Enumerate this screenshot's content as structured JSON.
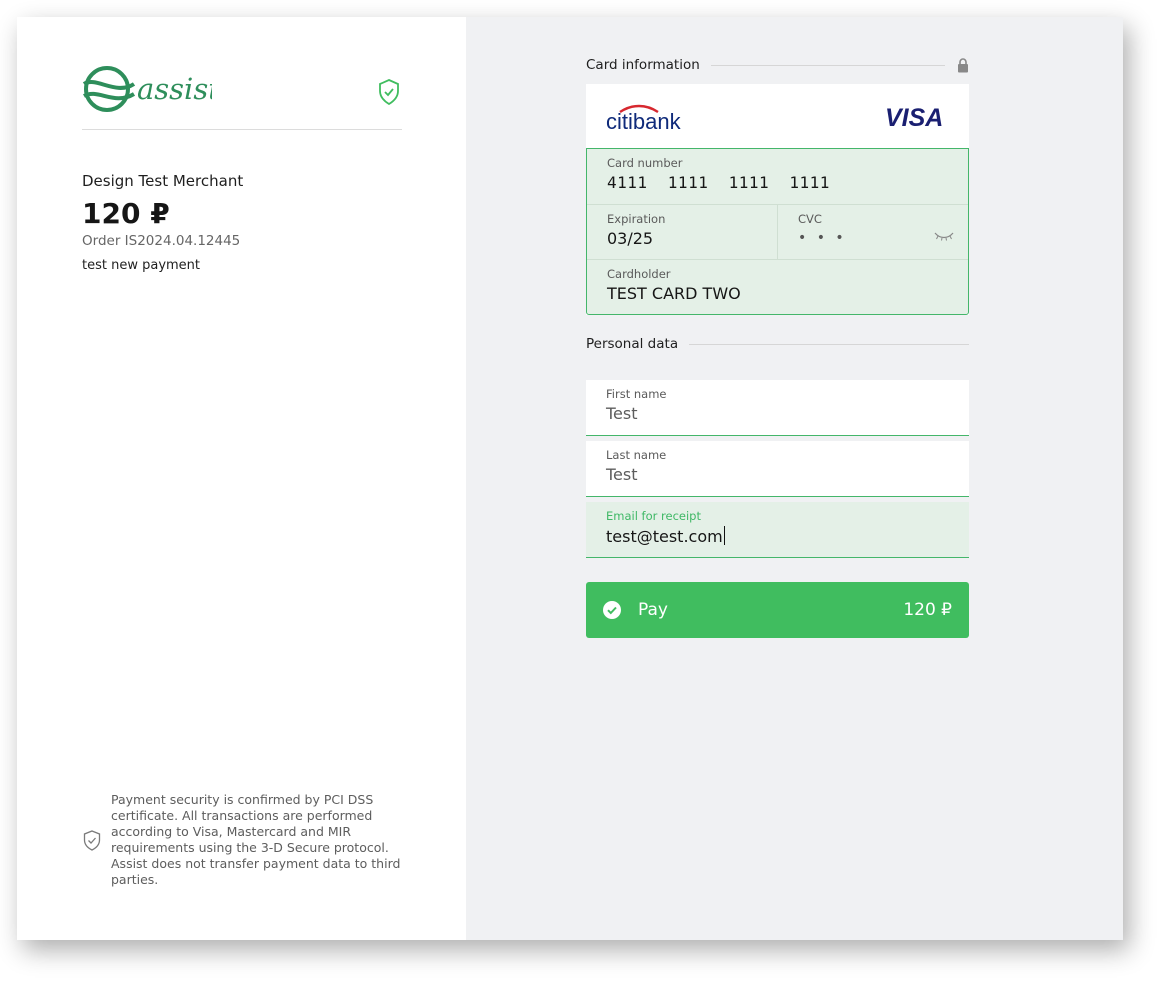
{
  "brand": {
    "name": "assist",
    "accent": "#40bd5f",
    "logo_color": "#2e8e5b"
  },
  "merchant": {
    "name": "Design Test Merchant",
    "amount": "120 ₽",
    "order": "Order IS2024.04.12445",
    "description": "test new payment"
  },
  "security_note": "Payment security is confirmed by PCI DSS certificate. All transactions are performed according to Visa, Mastercard and MIR requirements using the 3-D Secure protocol. Assist does not transfer payment data to third parties.",
  "card": {
    "section_title": "Card information",
    "bank": "citibank",
    "network": "VISA",
    "number": {
      "label": "Card number",
      "value": "4111  1111  1111  1111"
    },
    "expiration": {
      "label": "Expiration",
      "value": "03/25"
    },
    "cvc": {
      "label": "CVC",
      "value": "• • •"
    },
    "cardholder": {
      "label": "Cardholder",
      "value": "TEST CARD TWO"
    }
  },
  "personal": {
    "section_title": "Personal data",
    "first_name": {
      "label": "First name",
      "value": "Test"
    },
    "last_name": {
      "label": "Last name",
      "value": "Test"
    },
    "email": {
      "label": "Email for receipt",
      "value": "test@test.com"
    }
  },
  "pay_button": {
    "label": "Pay",
    "amount": "120 ₽"
  },
  "icons": [
    "assist-logo",
    "shield-check-icon",
    "lock-icon",
    "citibank-logo",
    "visa-logo",
    "eye-closed-icon",
    "check-circle-icon"
  ]
}
